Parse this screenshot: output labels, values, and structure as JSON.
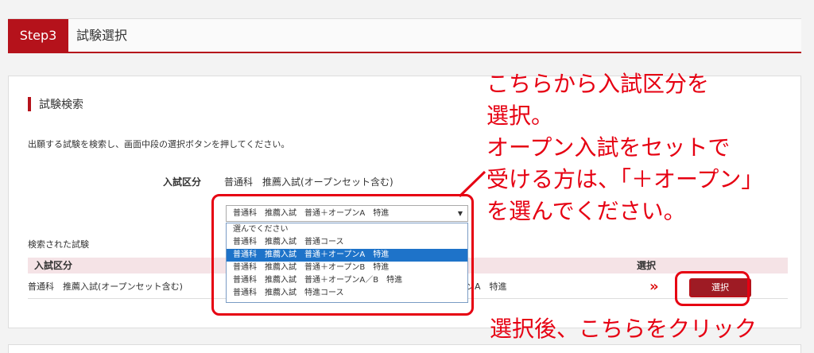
{
  "step": {
    "badge": "Step3",
    "title": "試験選択"
  },
  "section": {
    "title": "試験検索",
    "description": "出願する試験を検索し、画面中段の選択ボタンを押してください。"
  },
  "form": {
    "field_label": "入試区分",
    "field_value": "普通科　推薦入試(オープンセット含む)",
    "select_value": "普通科　推薦入試　普通＋オープンA　特進",
    "options": [
      "選んでください",
      "普通科　推薦入試　普通コース",
      "普通科　推薦入試　普通＋オープンA　特進",
      "普通科　推薦入試　普通＋オープンB　特進",
      "普通科　推薦入試　普通＋オープンA／B　特進",
      "普通科　推薦入試　特進コース"
    ],
    "selected_index": 2
  },
  "results": {
    "label": "検索された試験",
    "headers": {
      "category": "入試区分",
      "select": "選択"
    },
    "row": {
      "category": "普通科　推薦入試(オープンセット含む)",
      "exam_tail": "プンA　特進",
      "chevron": "»",
      "button": "選択"
    }
  },
  "annotations": {
    "main": "こちらから入試区分を\n選択。\nオープン入試をセットで\n受ける方は、「＋オープン」\nを選んでください。",
    "bottom": "選択後、こちらをクリック",
    "color": "#e60012"
  },
  "colors": {
    "accent": "#b5121b",
    "dropdown_highlight": "#1e73c9",
    "table_header_bg": "#f5e3e6"
  }
}
